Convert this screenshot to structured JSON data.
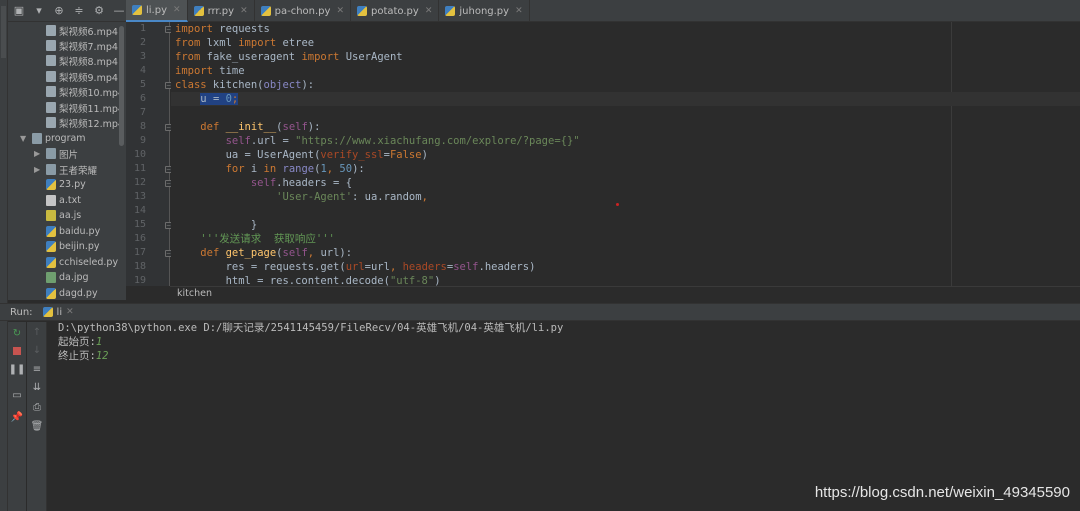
{
  "project_tree": {
    "items": [
      {
        "label": "梨视频6.mp4",
        "icon": "file-icon"
      },
      {
        "label": "梨视频7.mp4",
        "icon": "file-icon"
      },
      {
        "label": "梨视频8.mp4",
        "icon": "file-icon"
      },
      {
        "label": "梨视频9.mp4",
        "icon": "file-icon"
      },
      {
        "label": "梨视频10.mp4",
        "icon": "file-icon"
      },
      {
        "label": "梨视频11.mp4",
        "icon": "file-icon"
      },
      {
        "label": "梨视频12.mp4",
        "icon": "file-icon"
      },
      {
        "label": "program",
        "icon": "folder-icon"
      },
      {
        "label": "图片",
        "icon": "folder-icon"
      },
      {
        "label": "王者荣耀",
        "icon": "folder-icon"
      },
      {
        "label": "23.py",
        "icon": "python-file-icon"
      },
      {
        "label": "a.txt",
        "icon": "text-file-icon"
      },
      {
        "label": "aa.js",
        "icon": "js-file-icon"
      },
      {
        "label": "baidu.py",
        "icon": "python-file-icon"
      },
      {
        "label": "beijin.py",
        "icon": "python-file-icon"
      },
      {
        "label": "cchiseled.py",
        "icon": "python-file-icon"
      },
      {
        "label": "da.jpg",
        "icon": "image-file-icon"
      },
      {
        "label": "dagd.py",
        "icon": "python-file-icon"
      }
    ]
  },
  "tabs": [
    {
      "label": "li.py",
      "active": true
    },
    {
      "label": "rrr.py",
      "active": false
    },
    {
      "label": "pa-chon.py",
      "active": false
    },
    {
      "label": "potato.py",
      "active": false
    },
    {
      "label": "juhong.py",
      "active": false
    }
  ],
  "editor": {
    "line_numbers": [
      "1",
      "2",
      "3",
      "4",
      "5",
      "6",
      "7",
      "8",
      "9",
      "10",
      "11",
      "12",
      "13",
      "14",
      "15",
      "16",
      "17",
      "18",
      "19"
    ],
    "lines": [
      "import requests",
      "from lxml import etree",
      "from fake_useragent import UserAgent",
      "import time",
      "class kitchen(object):",
      "    u = 0;",
      "",
      "    def __init__(self):",
      "        self.url = \"https://www.xiachufang.com/explore/?page={}\"",
      "        ua = UserAgent(verify_ssl=False)",
      "        for i in range(1, 50):",
      "            self.headers = {",
      "                'User-Agent': ua.random,",
      "",
      "            }",
      "    '''发送请求  获取响应'''",
      "    def get_page(self, url):",
      "        res = requests.get(url=url, headers=self.headers)",
      "        html = res.content.decode(\"utf-8\")"
    ],
    "breadcrumb": "kitchen"
  },
  "run_panel": {
    "label": "Run:",
    "tab": "li",
    "console": {
      "command": "D:\\python38\\python.exe D:/聊天记录/2541145459/FileRecv/04-英雄飞机/04-英雄飞机/li.py",
      "prompt1": "起始页:",
      "input1": "1",
      "prompt2": "终止页:",
      "input2": "12"
    }
  },
  "watermark": "https://blog.csdn.net/weixin_49345590",
  "colors": {
    "background": "#2b2b2b",
    "panel": "#3c3f41",
    "keyword": "#cc7832",
    "string": "#6a8759",
    "number": "#6897bb",
    "accent": "#4a88c7"
  }
}
